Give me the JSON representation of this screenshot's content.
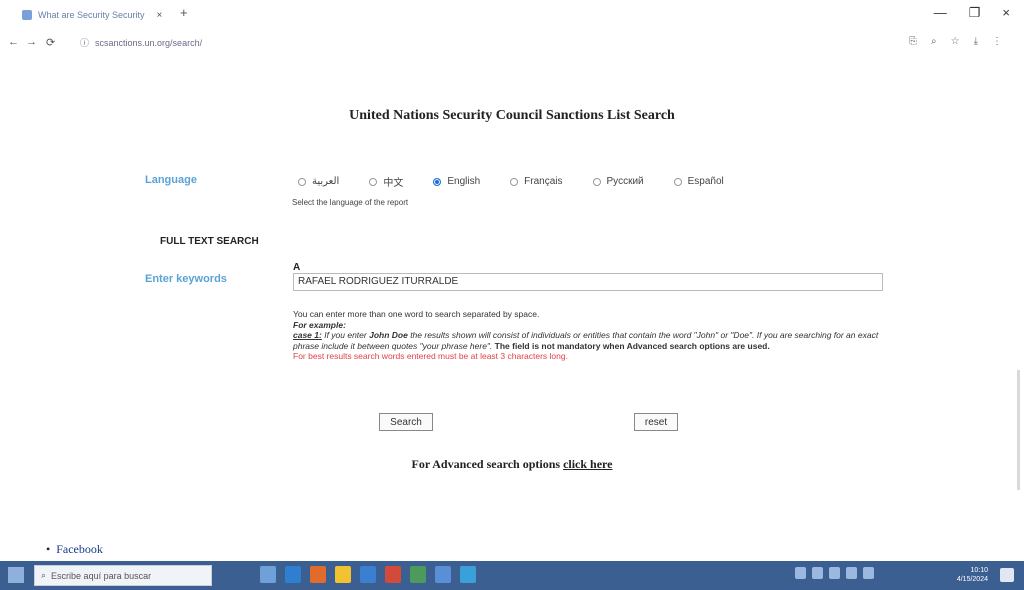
{
  "browser": {
    "tab_title": "What are Security Security",
    "tab_close": "×",
    "new_tab": "+",
    "url": "scsanctions.un.org/search/",
    "window_controls": {
      "minimize": "—",
      "maximize": "❐",
      "close": "×"
    },
    "nav": {
      "back": "←",
      "forward": "→",
      "reload": "⟳"
    },
    "address_icons": [
      "translate-icon",
      "zoom-icon",
      "star-icon",
      "download-icon",
      "menu-icon"
    ]
  },
  "page": {
    "title": "United Nations Security Council Sanctions List Search",
    "language_label": "Language",
    "languages": [
      {
        "label": "العربية",
        "selected": false
      },
      {
        "label": "中文",
        "selected": false
      },
      {
        "label": "English",
        "selected": true
      },
      {
        "label": "Français",
        "selected": false
      },
      {
        "label": "Русский",
        "selected": false
      },
      {
        "label": "Español",
        "selected": false
      }
    ],
    "language_hint": "Select the language of the report",
    "full_text_heading": "FULL TEXT SEARCH",
    "keywords_label": "Enter keywords",
    "keywords_prefix": "A",
    "keywords_value": "RAFAEL RODRIGUEZ ITURRALDE",
    "help_1": "You can enter more than one word to search separated by space.",
    "help_example": "For example:",
    "help_case_prefix": "case 1:",
    "help_case_a": " If you enter ",
    "help_case_term": "John Doe",
    "help_case_b": " the results shown will consist of individuals or entities that contain the word \"John\" or \"Doe\". If you are searching for an exact phrase include it between quotes \"your phrase here\". ",
    "help_case_c": "The field is not mandatory when Advanced search options are used.",
    "help_red": "For best results search words entered must be at least 3 characters long.",
    "search_button": "Search",
    "reset_button": "reset",
    "advanced_prefix": "For Advanced search options ",
    "advanced_link": "click here",
    "facebook_link": "Facebook"
  },
  "taskbar": {
    "search_placeholder": "Escribe aquí para buscar",
    "app_colors": [
      "#6fa0d8",
      "#2f7fd1",
      "#e06b2a",
      "#f2c230",
      "#3b7fd0",
      "#d44a3a",
      "#4c9a5c",
      "#5a8fd8",
      "#3aa0d8"
    ],
    "clock_time": "10:10",
    "clock_date": "4/15/2024"
  }
}
